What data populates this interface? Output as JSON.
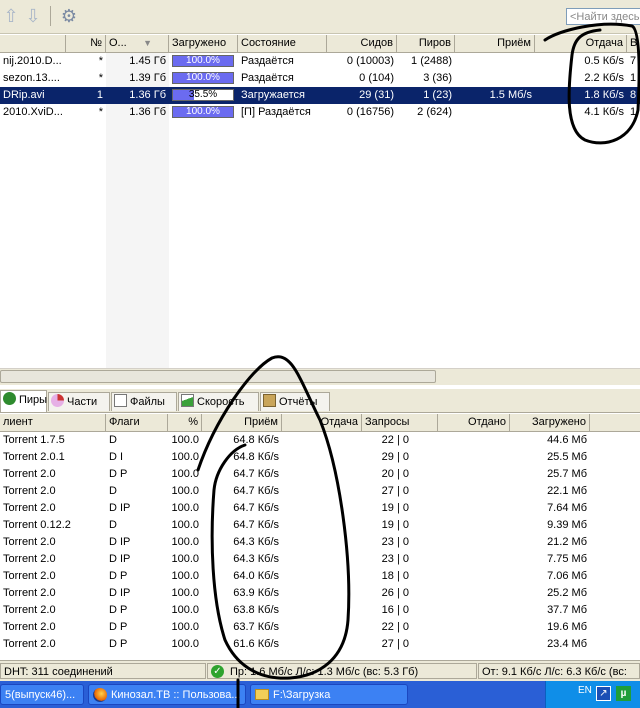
{
  "toolbar": {
    "search_placeholder": "<Найти здесь>",
    "icons": [
      "arrow-up-icon",
      "arrow-down-icon",
      "gear-icon"
    ]
  },
  "torrents": {
    "columns": [
      "№",
      "О...",
      "Загружено",
      "Состояние",
      "Сидов",
      "Пиров",
      "Приём",
      "Отдача",
      "В"
    ],
    "rows": [
      {
        "name": "nij.2010.D...",
        "num": "*",
        "size": "1.45 Гб",
        "progress": "100.0%",
        "progress_value": 100,
        "status": "Раздаётся",
        "seeds": "0 (10003)",
        "peers": "1 (2488)",
        "down": "",
        "up": "0.5 Кб/s",
        "extra": "7"
      },
      {
        "name": "sezon.13....",
        "num": "*",
        "size": "1.39 Гб",
        "progress": "100.0%",
        "progress_value": 100,
        "status": "Раздаётся",
        "seeds": "0 (104)",
        "peers": "3 (36)",
        "down": "",
        "up": "2.2 Кб/s",
        "extra": "1"
      },
      {
        "name": "DRip.avi",
        "num": "1",
        "size": "1.36 Гб",
        "progress": "35.5%",
        "progress_value": 35.5,
        "status": "Загружается",
        "seeds": "29 (31)",
        "peers": "1 (23)",
        "down": "1.5 Мб/s",
        "up": "1.8 Кб/s",
        "extra": "8"
      },
      {
        "name": "2010.XviD...",
        "num": "*",
        "size": "1.36 Гб",
        "progress": "100.0%",
        "progress_value": 100,
        "status": "[П] Раздаётся",
        "seeds": "0 (16756)",
        "peers": "2 (624)",
        "down": "",
        "up": "4.1 Кб/s",
        "extra": "1"
      }
    ]
  },
  "tabs": [
    {
      "label": "Пиры",
      "icon": "peers-icon"
    },
    {
      "label": "Части",
      "icon": "pieces-icon"
    },
    {
      "label": "Файлы",
      "icon": "files-icon"
    },
    {
      "label": "Скорость",
      "icon": "speed-icon"
    },
    {
      "label": "Отчёты",
      "icon": "logs-icon"
    }
  ],
  "peers": {
    "columns": [
      "лиент",
      "Флаги",
      "%",
      "Приём",
      "Отдача",
      "Запросы",
      "Отдано",
      "Загружено"
    ],
    "rows": [
      {
        "client": "Torrent 1.7.5",
        "flags": "D",
        "pct": "100.0",
        "down": "64.8 Кб/s",
        "up": "",
        "req": "22 | 0",
        "sent": "",
        "recv": "44.6 Мб"
      },
      {
        "client": "Torrent 2.0.1",
        "flags": "D I",
        "pct": "100.0",
        "down": "64.8 Кб/s",
        "up": "",
        "req": "29 | 0",
        "sent": "",
        "recv": "25.5 Мб"
      },
      {
        "client": "Torrent 2.0",
        "flags": "D P",
        "pct": "100.0",
        "down": "64.7 Кб/s",
        "up": "",
        "req": "20 | 0",
        "sent": "",
        "recv": "25.7 Мб"
      },
      {
        "client": "Torrent 2.0",
        "flags": "D",
        "pct": "100.0",
        "down": "64.7 Кб/s",
        "up": "",
        "req": "27 | 0",
        "sent": "",
        "recv": "22.1 Мб"
      },
      {
        "client": "Torrent 2.0",
        "flags": "D IP",
        "pct": "100.0",
        "down": "64.7 Кб/s",
        "up": "",
        "req": "19 | 0",
        "sent": "",
        "recv": "7.64 Мб"
      },
      {
        "client": "Torrent 0.12.2",
        "flags": "D",
        "pct": "100.0",
        "down": "64.7 Кб/s",
        "up": "",
        "req": "19 | 0",
        "sent": "",
        "recv": "9.39 Мб"
      },
      {
        "client": "Torrent 2.0",
        "flags": "D IP",
        "pct": "100.0",
        "down": "64.3 Кб/s",
        "up": "",
        "req": "23 | 0",
        "sent": "",
        "recv": "21.2 Мб"
      },
      {
        "client": "Torrent 2.0",
        "flags": "D IP",
        "pct": "100.0",
        "down": "64.3 Кб/s",
        "up": "",
        "req": "23 | 0",
        "sent": "",
        "recv": "7.75 Мб"
      },
      {
        "client": "Torrent 2.0",
        "flags": "D P",
        "pct": "100.0",
        "down": "64.0 Кб/s",
        "up": "",
        "req": "18 | 0",
        "sent": "",
        "recv": "7.06 Мб"
      },
      {
        "client": "Torrent 2.0",
        "flags": "D IP",
        "pct": "100.0",
        "down": "63.9 Кб/s",
        "up": "",
        "req": "26 | 0",
        "sent": "",
        "recv": "25.2 Мб"
      },
      {
        "client": "Torrent 2.0",
        "flags": "D P",
        "pct": "100.0",
        "down": "63.8 Кб/s",
        "up": "",
        "req": "16 | 0",
        "sent": "",
        "recv": "37.7 Мб"
      },
      {
        "client": "Torrent 2.0",
        "flags": "D P",
        "pct": "100.0",
        "down": "63.7 Кб/s",
        "up": "",
        "req": "22 | 0",
        "sent": "",
        "recv": "19.6 Мб"
      },
      {
        "client": "Torrent 2.0",
        "flags": "D P",
        "pct": "100.0",
        "down": "61.6 Кб/s",
        "up": "",
        "req": "27 | 0",
        "sent": "",
        "recv": "23.4 Мб"
      }
    ]
  },
  "status": {
    "dht": "DHT: 311 соединений",
    "down": "Пр: 1.6 Мб/с Л/с: 1.3 Мб/с (вс: 5.3 Гб)",
    "up": "От: 9.1 Кб/с Л/с: 6.3 Кб/с (вс:"
  },
  "taskbar": {
    "items": [
      "5(выпуск46)...",
      "Кинозал.ТВ :: Пользова...",
      "F:\\Загрузка"
    ],
    "lang": "EN"
  },
  "colors": {
    "selection": "#0a246a",
    "progress": "#6b6bf0",
    "taskbar": "#2a5fd6",
    "chrome": "#ece9d8",
    "annotation": "#000000"
  }
}
